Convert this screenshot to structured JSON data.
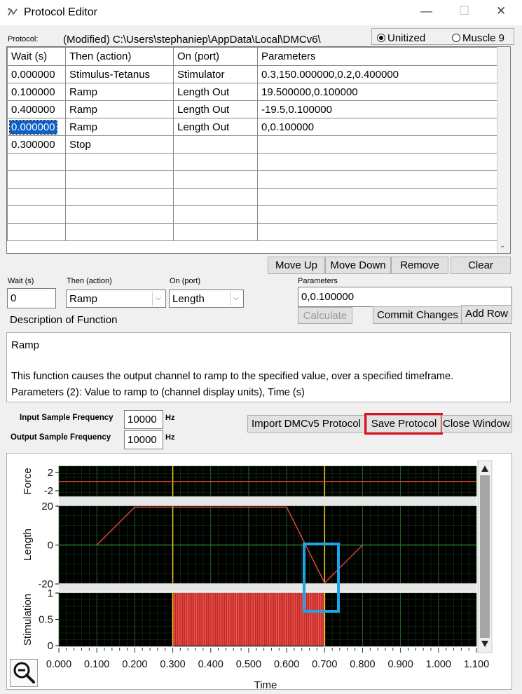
{
  "window": {
    "title": "Protocol Editor",
    "minimize": "—",
    "maximize": "☐",
    "close": "✕"
  },
  "protocol": {
    "label": "Protocol:",
    "path": "(Modified) C:\\Users\\stephaniep\\AppData\\Local\\DMCv6\\",
    "mode_unitized": "Unitized",
    "mode_muscle": "Muscle 9"
  },
  "table": {
    "headers": [
      "Wait (s)",
      "Then (action)",
      "On (port)",
      "Parameters"
    ],
    "rows": [
      [
        "0.000000",
        "Stimulus-Tetanus",
        "Stimulator",
        "0.3,150.000000,0.2,0.400000"
      ],
      [
        "0.100000",
        "Ramp",
        "Length Out",
        "19.500000,0.100000"
      ],
      [
        "0.400000",
        "Ramp",
        "Length Out",
        "-19.5,0.100000"
      ],
      [
        "0.000000",
        "Ramp",
        "Length Out",
        "0,0.100000"
      ],
      [
        "0.300000",
        "Stop",
        "",
        ""
      ],
      [
        "",
        "",
        "",
        ""
      ],
      [
        "",
        "",
        "",
        ""
      ],
      [
        "",
        "",
        "",
        ""
      ],
      [
        "",
        "",
        "",
        ""
      ],
      [
        "",
        "",
        "",
        ""
      ]
    ]
  },
  "row_buttons": {
    "move_up": "Move Up",
    "move_down": "Move Down",
    "remove": "Remove",
    "clear": "Clear"
  },
  "editor": {
    "wait_label": "Wait (s)",
    "wait_value": "0",
    "action_label": "Then (action)",
    "action_value": "Ramp",
    "port_label": "On (port)",
    "port_value": "Length",
    "params_label": "Parameters",
    "params_value": "0,0.100000",
    "calculate": "Calculate",
    "commit": "Commit Changes",
    "add_row": "Add Row"
  },
  "description": {
    "label": "Description of Function",
    "name": "Ramp",
    "line1": "This function causes the output channel to ramp to the specified value, over a specified timeframe.",
    "line2": "Parameters (2): Value to ramp to (channel display units), Time (s)"
  },
  "sampling": {
    "input_label": "Input Sample Frequency",
    "input_value": "10000",
    "input_unit": "Hz",
    "output_label": "Output Sample Frequency",
    "output_value": "10000",
    "output_unit": "Hz"
  },
  "actions": {
    "import": "Import DMCv5 Protocol",
    "save": "Save Protocol",
    "close": "Close Window"
  },
  "icons": {
    "zoom": "zoom-out-icon",
    "app": "protocol-editor-icon"
  },
  "colors": {
    "highlight_red": "#e3101c",
    "highlight_blue": "#1ea3e6",
    "trace_red": "#e8473f",
    "marker_yellow": "#e6c619",
    "plot_bg": "#000000"
  },
  "chart_data": [
    {
      "type": "line",
      "ylabel": "Force",
      "ylim": [
        -2,
        2
      ],
      "yticks": [
        "2",
        "-2"
      ],
      "series": [
        {
          "x": [
            0.0,
            1.1
          ],
          "y": [
            0,
            0
          ]
        }
      ],
      "grid": true
    },
    {
      "type": "line",
      "ylabel": "Length",
      "ylim": [
        -20,
        20
      ],
      "yticks": [
        "20",
        "0",
        "-20"
      ],
      "series": [
        {
          "x": [
            0.1,
            0.2,
            0.6,
            0.7,
            0.8
          ],
          "y": [
            0,
            19.5,
            19.5,
            -19.5,
            0
          ]
        }
      ],
      "grid": true
    },
    {
      "type": "bar",
      "ylabel": "Stimulation",
      "ylim": [
        0,
        1
      ],
      "yticks": [
        "1",
        "0.5",
        "0"
      ],
      "pulse_train": {
        "start": 0.3,
        "end": 0.7,
        "amplitude": 1
      },
      "grid": true
    }
  ],
  "x_axis": {
    "xlabel": "Time",
    "xlim": [
      0,
      1.1
    ],
    "ticks": [
      "0.000",
      "0.100",
      "0.200",
      "0.300",
      "0.400",
      "0.500",
      "0.600",
      "0.700",
      "0.800",
      "0.900",
      "1.000",
      "1.100"
    ],
    "markers": [
      0.3,
      0.7
    ]
  }
}
